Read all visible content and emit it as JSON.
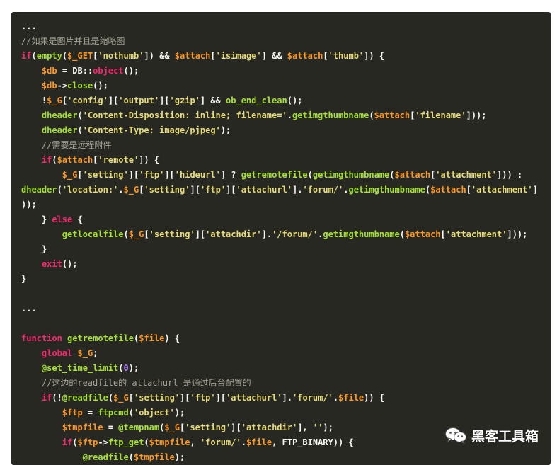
{
  "code_lines": [
    [
      {
        "t": "...",
        "c": "p"
      }
    ],
    [
      {
        "t": "//如果是图片并且是缩略图",
        "c": "c"
      }
    ],
    [
      {
        "t": "if",
        "c": "k"
      },
      {
        "t": "(",
        "c": "p"
      },
      {
        "t": "empty",
        "c": "f"
      },
      {
        "t": "(",
        "c": "p"
      },
      {
        "t": "$_GET",
        "c": "v"
      },
      {
        "t": "[",
        "c": "p"
      },
      {
        "t": "'nothumb'",
        "c": "s"
      },
      {
        "t": "]) && ",
        "c": "p"
      },
      {
        "t": "$attach",
        "c": "v"
      },
      {
        "t": "[",
        "c": "p"
      },
      {
        "t": "'isimage'",
        "c": "s"
      },
      {
        "t": "] && ",
        "c": "p"
      },
      {
        "t": "$attach",
        "c": "v"
      },
      {
        "t": "[",
        "c": "p"
      },
      {
        "t": "'thumb'",
        "c": "s"
      },
      {
        "t": "]) {",
        "c": "p"
      }
    ],
    [
      {
        "t": "    ",
        "c": "p"
      },
      {
        "t": "$db",
        "c": "v"
      },
      {
        "t": " = DB::",
        "c": "p"
      },
      {
        "t": "object",
        "c": "k"
      },
      {
        "t": "();",
        "c": "p"
      }
    ],
    [
      {
        "t": "    ",
        "c": "p"
      },
      {
        "t": "$db",
        "c": "v"
      },
      {
        "t": "->",
        "c": "p"
      },
      {
        "t": "close",
        "c": "f"
      },
      {
        "t": "();",
        "c": "p"
      }
    ],
    [
      {
        "t": "    !",
        "c": "p"
      },
      {
        "t": "$_G",
        "c": "v"
      },
      {
        "t": "[",
        "c": "p"
      },
      {
        "t": "'config'",
        "c": "s"
      },
      {
        "t": "][",
        "c": "p"
      },
      {
        "t": "'output'",
        "c": "s"
      },
      {
        "t": "][",
        "c": "p"
      },
      {
        "t": "'gzip'",
        "c": "s"
      },
      {
        "t": "] && ",
        "c": "p"
      },
      {
        "t": "ob_end_clean",
        "c": "f"
      },
      {
        "t": "();",
        "c": "p"
      }
    ],
    [
      {
        "t": "    ",
        "c": "p"
      },
      {
        "t": "dheader",
        "c": "f"
      },
      {
        "t": "(",
        "c": "p"
      },
      {
        "t": "'Content-Disposition: inline; filename='",
        "c": "s"
      },
      {
        "t": ".",
        "c": "p"
      },
      {
        "t": "getimgthumbname",
        "c": "f"
      },
      {
        "t": "(",
        "c": "p"
      },
      {
        "t": "$attach",
        "c": "v"
      },
      {
        "t": "[",
        "c": "p"
      },
      {
        "t": "'filename'",
        "c": "s"
      },
      {
        "t": "]));",
        "c": "p"
      }
    ],
    [
      {
        "t": "    ",
        "c": "p"
      },
      {
        "t": "dheader",
        "c": "f"
      },
      {
        "t": "(",
        "c": "p"
      },
      {
        "t": "'Content-Type: image/pjpeg'",
        "c": "s"
      },
      {
        "t": ");",
        "c": "p"
      }
    ],
    [
      {
        "t": "    ",
        "c": "p"
      },
      {
        "t": "//需要是远程附件",
        "c": "c"
      }
    ],
    [
      {
        "t": "    ",
        "c": "p"
      },
      {
        "t": "if",
        "c": "k"
      },
      {
        "t": "(",
        "c": "p"
      },
      {
        "t": "$attach",
        "c": "v"
      },
      {
        "t": "[",
        "c": "p"
      },
      {
        "t": "'remote'",
        "c": "s"
      },
      {
        "t": "]) {",
        "c": "p"
      }
    ],
    [
      {
        "t": "        ",
        "c": "p"
      },
      {
        "t": "$_G",
        "c": "v"
      },
      {
        "t": "[",
        "c": "p"
      },
      {
        "t": "'setting'",
        "c": "s"
      },
      {
        "t": "][",
        "c": "p"
      },
      {
        "t": "'ftp'",
        "c": "s"
      },
      {
        "t": "][",
        "c": "p"
      },
      {
        "t": "'hideurl'",
        "c": "s"
      },
      {
        "t": "] ? ",
        "c": "p"
      },
      {
        "t": "getremotefile",
        "c": "f"
      },
      {
        "t": "(",
        "c": "p"
      },
      {
        "t": "getimgthumbname",
        "c": "f"
      },
      {
        "t": "(",
        "c": "p"
      },
      {
        "t": "$attach",
        "c": "v"
      },
      {
        "t": "[",
        "c": "p"
      },
      {
        "t": "'attachment'",
        "c": "s"
      },
      {
        "t": "])) :",
        "c": "p"
      }
    ],
    [
      {
        "t": "dheader",
        "c": "f"
      },
      {
        "t": "(",
        "c": "p"
      },
      {
        "t": "'location:'",
        "c": "s"
      },
      {
        "t": ".",
        "c": "p"
      },
      {
        "t": "$_G",
        "c": "v"
      },
      {
        "t": "[",
        "c": "p"
      },
      {
        "t": "'setting'",
        "c": "s"
      },
      {
        "t": "][",
        "c": "p"
      },
      {
        "t": "'ftp'",
        "c": "s"
      },
      {
        "t": "][",
        "c": "p"
      },
      {
        "t": "'attachurl'",
        "c": "s"
      },
      {
        "t": "].",
        "c": "p"
      },
      {
        "t": "'forum/'",
        "c": "s"
      },
      {
        "t": ".",
        "c": "p"
      },
      {
        "t": "getimgthumbname",
        "c": "f"
      },
      {
        "t": "(",
        "c": "p"
      },
      {
        "t": "$attach",
        "c": "v"
      },
      {
        "t": "[",
        "c": "p"
      },
      {
        "t": "'attachment'",
        "c": "s"
      },
      {
        "t": "]",
        "c": "p"
      }
    ],
    [
      {
        "t": "));",
        "c": "p"
      }
    ],
    [
      {
        "t": "    } ",
        "c": "p"
      },
      {
        "t": "else",
        "c": "k"
      },
      {
        "t": " {",
        "c": "p"
      }
    ],
    [
      {
        "t": "        ",
        "c": "p"
      },
      {
        "t": "getlocalfile",
        "c": "f"
      },
      {
        "t": "(",
        "c": "p"
      },
      {
        "t": "$_G",
        "c": "v"
      },
      {
        "t": "[",
        "c": "p"
      },
      {
        "t": "'setting'",
        "c": "s"
      },
      {
        "t": "][",
        "c": "p"
      },
      {
        "t": "'attachdir'",
        "c": "s"
      },
      {
        "t": "].",
        "c": "p"
      },
      {
        "t": "'/forum/'",
        "c": "s"
      },
      {
        "t": ".",
        "c": "p"
      },
      {
        "t": "getimgthumbname",
        "c": "f"
      },
      {
        "t": "(",
        "c": "p"
      },
      {
        "t": "$attach",
        "c": "v"
      },
      {
        "t": "[",
        "c": "p"
      },
      {
        "t": "'attachment'",
        "c": "s"
      },
      {
        "t": "]));",
        "c": "p"
      }
    ],
    [
      {
        "t": "    }",
        "c": "p"
      }
    ],
    [
      {
        "t": "    ",
        "c": "p"
      },
      {
        "t": "exit",
        "c": "k"
      },
      {
        "t": "();",
        "c": "p"
      }
    ],
    [
      {
        "t": "}",
        "c": "p"
      }
    ],
    [],
    [
      {
        "t": "...",
        "c": "p"
      }
    ],
    [],
    [
      {
        "t": "function",
        "c": "k"
      },
      {
        "t": " ",
        "c": "p"
      },
      {
        "t": "getremotefile",
        "c": "f"
      },
      {
        "t": "(",
        "c": "p"
      },
      {
        "t": "$file",
        "c": "v"
      },
      {
        "t": ") {",
        "c": "p"
      }
    ],
    [
      {
        "t": "    ",
        "c": "p"
      },
      {
        "t": "global",
        "c": "k"
      },
      {
        "t": " ",
        "c": "p"
      },
      {
        "t": "$_G",
        "c": "v"
      },
      {
        "t": ";",
        "c": "p"
      }
    ],
    [
      {
        "t": "    ",
        "c": "p"
      },
      {
        "t": "@set_time_limit",
        "c": "f"
      },
      {
        "t": "(",
        "c": "p"
      },
      {
        "t": "0",
        "c": "n"
      },
      {
        "t": ");",
        "c": "p"
      }
    ],
    [
      {
        "t": "    ",
        "c": "p"
      },
      {
        "t": "//这边的readfile的 attachurl 是通过后台配置的",
        "c": "c"
      }
    ],
    [
      {
        "t": "    ",
        "c": "p"
      },
      {
        "t": "if",
        "c": "k"
      },
      {
        "t": "(!",
        "c": "p"
      },
      {
        "t": "@readfile",
        "c": "f"
      },
      {
        "t": "(",
        "c": "p"
      },
      {
        "t": "$_G",
        "c": "v"
      },
      {
        "t": "[",
        "c": "p"
      },
      {
        "t": "'setting'",
        "c": "s"
      },
      {
        "t": "][",
        "c": "p"
      },
      {
        "t": "'ftp'",
        "c": "s"
      },
      {
        "t": "][",
        "c": "p"
      },
      {
        "t": "'attachurl'",
        "c": "s"
      },
      {
        "t": "].",
        "c": "p"
      },
      {
        "t": "'forum/'",
        "c": "s"
      },
      {
        "t": ".",
        "c": "p"
      },
      {
        "t": "$file",
        "c": "v"
      },
      {
        "t": ")) {",
        "c": "p"
      }
    ],
    [
      {
        "t": "        ",
        "c": "p"
      },
      {
        "t": "$ftp",
        "c": "v"
      },
      {
        "t": " = ",
        "c": "p"
      },
      {
        "t": "ftpcmd",
        "c": "f"
      },
      {
        "t": "(",
        "c": "p"
      },
      {
        "t": "'object'",
        "c": "s"
      },
      {
        "t": ");",
        "c": "p"
      }
    ],
    [
      {
        "t": "        ",
        "c": "p"
      },
      {
        "t": "$tmpfile",
        "c": "v"
      },
      {
        "t": " = ",
        "c": "p"
      },
      {
        "t": "@tempnam",
        "c": "f"
      },
      {
        "t": "(",
        "c": "p"
      },
      {
        "t": "$_G",
        "c": "v"
      },
      {
        "t": "[",
        "c": "p"
      },
      {
        "t": "'setting'",
        "c": "s"
      },
      {
        "t": "][",
        "c": "p"
      },
      {
        "t": "'attachdir'",
        "c": "s"
      },
      {
        "t": "], ",
        "c": "p"
      },
      {
        "t": "''",
        "c": "s"
      },
      {
        "t": ");",
        "c": "p"
      }
    ],
    [
      {
        "t": "        ",
        "c": "p"
      },
      {
        "t": "if",
        "c": "k"
      },
      {
        "t": "(",
        "c": "p"
      },
      {
        "t": "$ftp",
        "c": "v"
      },
      {
        "t": "->",
        "c": "p"
      },
      {
        "t": "ftp_get",
        "c": "f"
      },
      {
        "t": "(",
        "c": "p"
      },
      {
        "t": "$tmpfile",
        "c": "v"
      },
      {
        "t": ", ",
        "c": "p"
      },
      {
        "t": "'forum/'",
        "c": "s"
      },
      {
        "t": ".",
        "c": "p"
      },
      {
        "t": "$file",
        "c": "v"
      },
      {
        "t": ", FTP_BINARY)) {",
        "c": "p"
      }
    ],
    [
      {
        "t": "            ",
        "c": "p"
      },
      {
        "t": "@readfile",
        "c": "f"
      },
      {
        "t": "(",
        "c": "p"
      },
      {
        "t": "$tmpfile",
        "c": "v"
      },
      {
        "t": ");",
        "c": "p"
      }
    ]
  ],
  "watermark": {
    "icon": "wechat-icon",
    "text": "黑客工具箱"
  },
  "colors": {
    "background": "#272822",
    "plain": "#f8f8f2",
    "keyword": "#f92672",
    "function": "#a6e22e",
    "variable": "#fd971f",
    "string": "#e6db74",
    "number": "#ae81ff",
    "comment": "#a7a496"
  }
}
